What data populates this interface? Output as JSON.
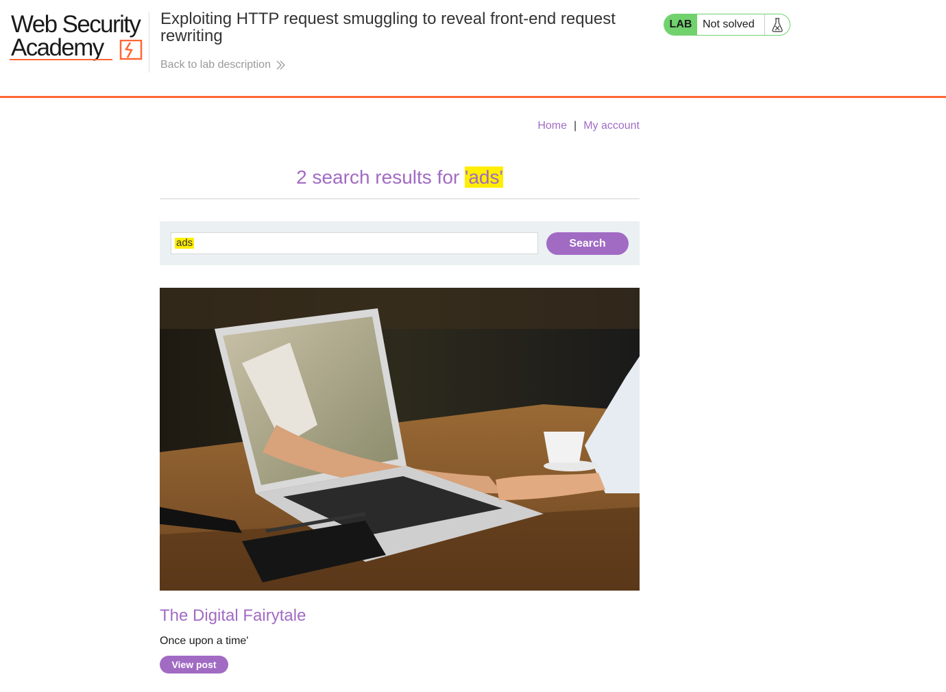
{
  "lab_header": {
    "logo_line1": "Web Security",
    "logo_line2": "Academy",
    "title": "Exploiting HTTP request smuggling to reveal front-end request rewriting",
    "back_link": "Back to lab description",
    "status_tag": "LAB",
    "status_text": "Not solved"
  },
  "nav": {
    "home": "Home",
    "separator": "|",
    "my_account": "My account"
  },
  "results": {
    "prefix": "2 search results for ",
    "open_quote": "'",
    "term": "ads",
    "close_quote": "'"
  },
  "search": {
    "value": "ads",
    "button_label": "Search"
  },
  "post": {
    "title": "The Digital Fairytale",
    "summary": "Once upon a time'",
    "button_label": "View post"
  },
  "colors": {
    "accent_purple": "#a16bc4",
    "brand_orange": "#ff6633",
    "status_green": "#70d16d",
    "highlight_yellow": "#ffee00"
  }
}
